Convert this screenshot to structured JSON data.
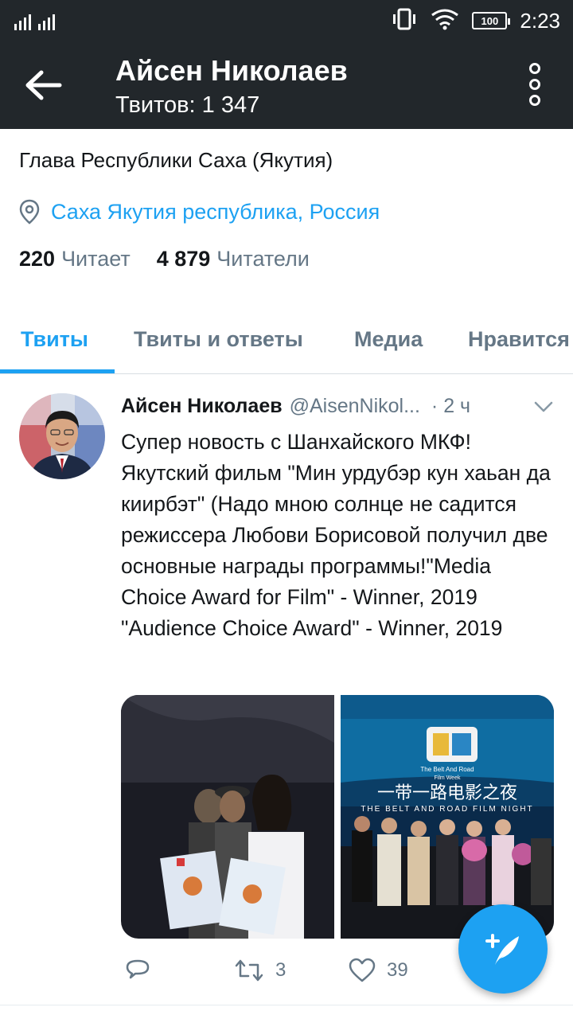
{
  "status_bar": {
    "time": "2:23",
    "battery": "100"
  },
  "header": {
    "title": "Айсен Николаев",
    "subtitle": "Твитов: 1 347"
  },
  "profile": {
    "bio": "Глава Республики Саха (Якутия)",
    "location": "Саха Якутия республика, Россия",
    "following_count": "220",
    "following_label": "Читает",
    "followers_count": "4 879",
    "followers_label": "Читатели"
  },
  "tabs": [
    {
      "label": "Твиты",
      "active": true
    },
    {
      "label": "Твиты и ответы",
      "active": false
    },
    {
      "label": "Медиа",
      "active": false
    },
    {
      "label": "Нравится",
      "active": false
    }
  ],
  "tweet": {
    "author": "Айсен Николаев",
    "handle": "@AisenNikol...",
    "time": "· 2 ч",
    "text": "Супер новость с Шанхайского МКФ! Якутский фильм \"Мин урдубэр кун хаьан да киирбэт\" (Надо мною солнце не садится режиссера Любови Борисовой получил две основные награды программы!\"Media Choice Award for Film\" - Winner, 2019 \"Audience Choice Award\" - Winner, 2019",
    "media_right_caption": {
      "event": "The Belt And Road",
      "week": "Film Week",
      "chinese": "一带一路电影之夜",
      "banner": "THE BELT AND ROAD FILM NIGHT"
    },
    "retweets": "3",
    "likes": "39"
  },
  "colors": {
    "accent": "#1da1f2",
    "appbar": "#22272b",
    "secondary_text": "#657786"
  },
  "icons": [
    "back-arrow-icon",
    "more-vertical-icon",
    "location-pin-icon",
    "chevron-down-icon",
    "reply-icon",
    "retweet-icon",
    "like-icon",
    "compose-tweet-icon"
  ]
}
